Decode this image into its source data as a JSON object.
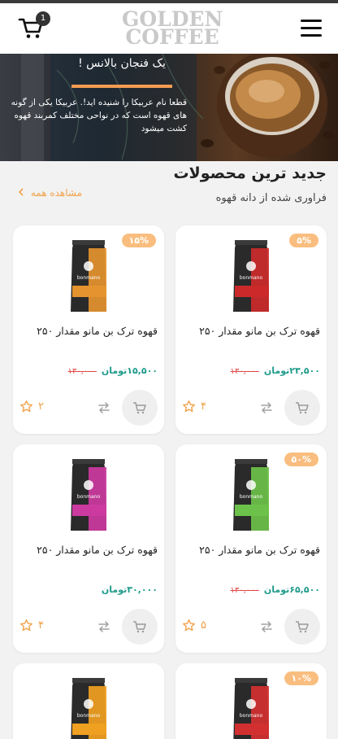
{
  "header": {
    "cart_count": "1",
    "logo_line1": "GOLDEN",
    "logo_line2": "COFFEE"
  },
  "banner": {
    "title": "یک فنجان بالانس !",
    "text": "قطعا نام عربیکا را شنیده اید!. عربیکا یکی از گونه های قهوه است که در نواحی مختلف کمربند قهوه کشت میشود"
  },
  "section": {
    "title": "جدید ترین محصولات",
    "subtitle": "فراوری شده از دانه قهوه",
    "see_all": "مشاهده همه"
  },
  "products": [
    {
      "name": "قهوه ترک بن مانو مقدار ۲۵۰",
      "discount": "۵%",
      "price": "۲۳,۵۰۰",
      "currency": "تومان",
      "old_price": "۱۳۰,۰۰۰",
      "rating": "۴",
      "bag_color": "#cc2a2a"
    },
    {
      "name": "قهوه ترک بن مانو مقدار ۲۵۰",
      "discount": "۱۵%",
      "price": "۱۵,۵۰۰",
      "currency": "تومان",
      "old_price": "۱۳۰,۰۰۰",
      "rating": "۲",
      "bag_color": "#e5932f"
    },
    {
      "name": "قهوه ترک بن مانو مقدار ۲۵۰",
      "discount": "۵۰%",
      "price": "۶۵,۵۰۰",
      "currency": "تومان",
      "old_price": "۱۳۰,۰۰۰",
      "rating": "۵",
      "bag_color": "#6cc14a"
    },
    {
      "name": "قهوه ترک بن مانو مقدار ۲۵۰",
      "discount": "",
      "price": "۳۰,۰۰۰",
      "currency": "تومان",
      "old_price": "",
      "rating": "۴",
      "bag_color": "#cc3aa0"
    },
    {
      "name": "",
      "discount": "۱۰%",
      "price": "",
      "currency": "",
      "old_price": "",
      "rating": "",
      "bag_color": "#d23030"
    },
    {
      "name": "",
      "discount": "",
      "price": "",
      "currency": "",
      "old_price": "",
      "rating": "",
      "bag_color": "#f0a020"
    }
  ],
  "colors": {
    "accent": "#f0a34a",
    "badge": "#f9be7f",
    "price": "#1f9a8a",
    "old_price": "#e04848"
  },
  "icons": {
    "cart": "cart-icon",
    "menu": "menu-icon",
    "star": "star-icon",
    "compare": "compare-icon",
    "add_to_cart": "add-to-cart-icon",
    "chevron": "chevron-left-icon"
  }
}
